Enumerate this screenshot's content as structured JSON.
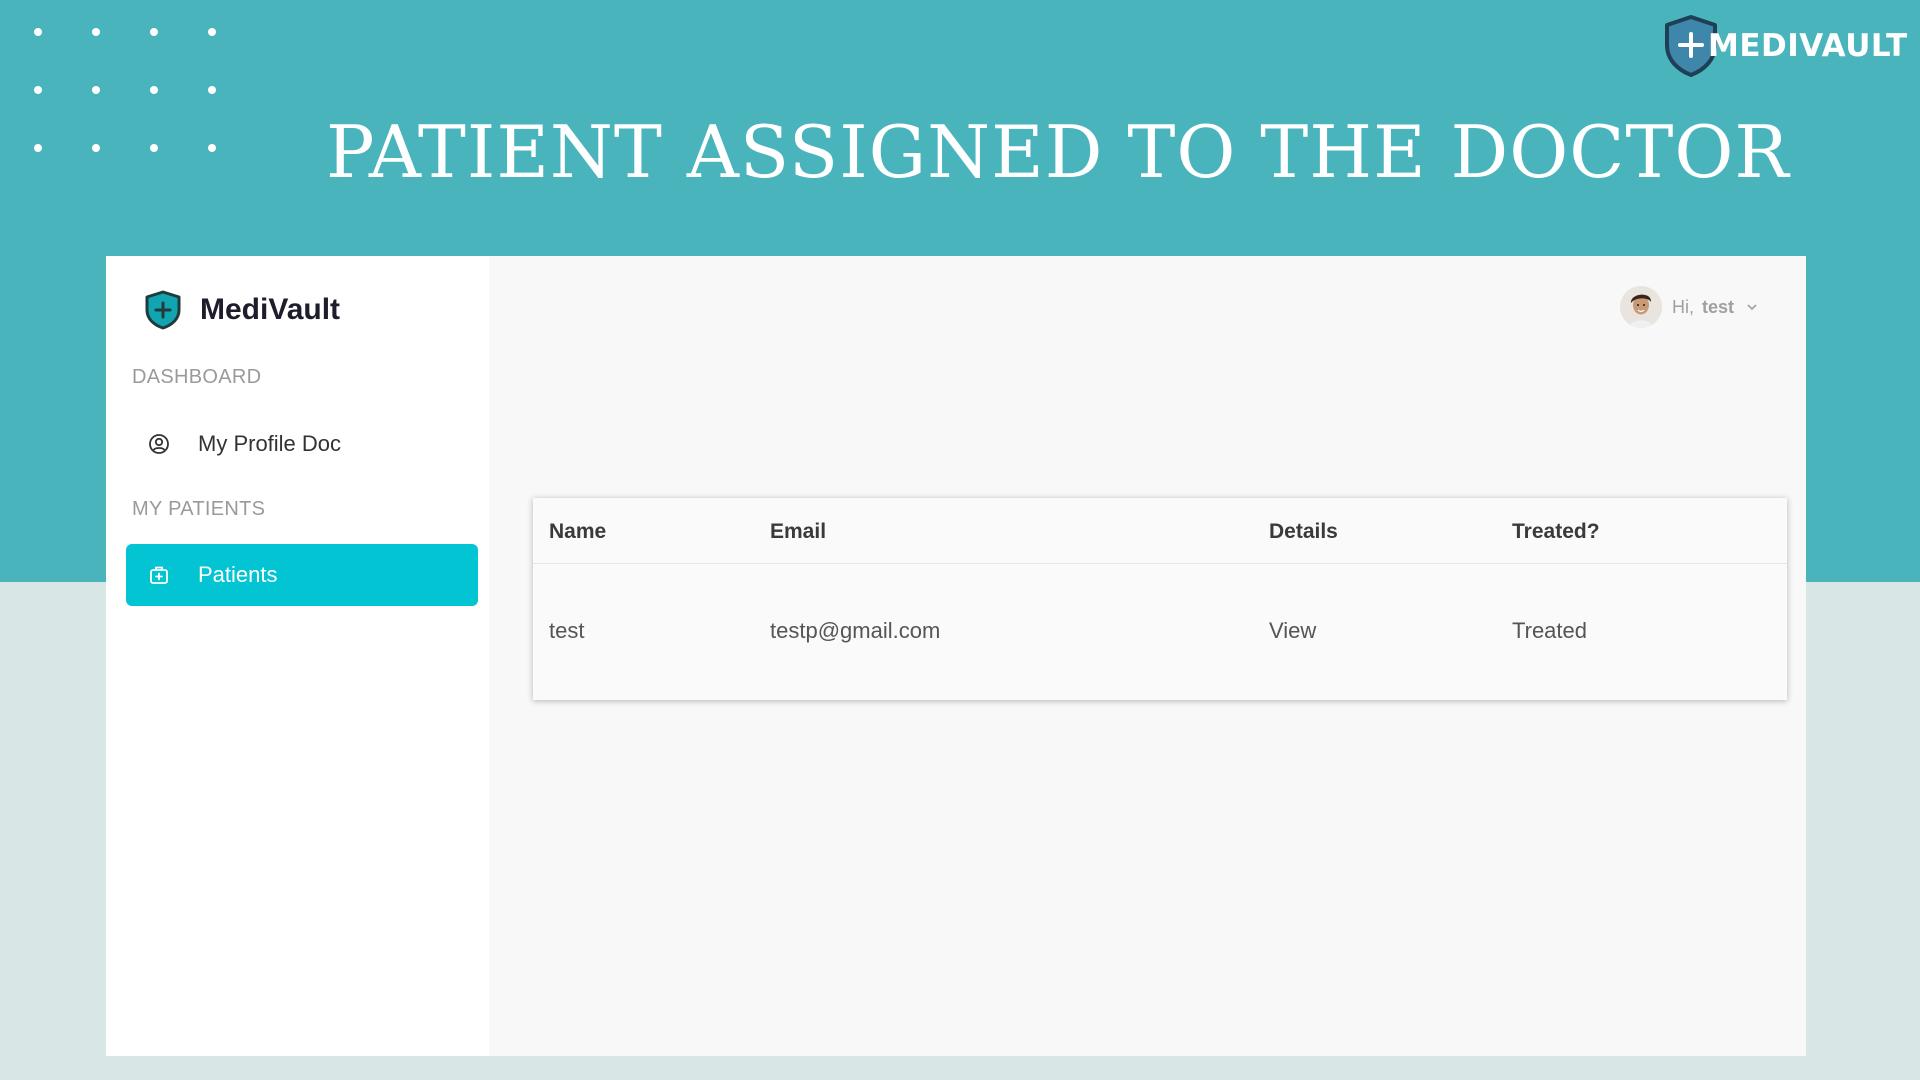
{
  "slide": {
    "title": "PATIENT ASSIGNED TO THE DOCTOR",
    "brand_label": "MEDIVAULT",
    "colors": {
      "banner": "#4ab4bd",
      "background": "#d9e6e6"
    }
  },
  "app": {
    "logo_text": "MediVault",
    "sidebar": {
      "sections": [
        {
          "label": "DASHBOARD",
          "items": [
            {
              "label": "My Profile Doc",
              "icon": "user-circle-icon",
              "active": false
            }
          ]
        },
        {
          "label": "MY PATIENTS",
          "items": [
            {
              "label": "Patients",
              "icon": "medical-bag-icon",
              "active": true
            }
          ]
        }
      ],
      "active_color": "#03c4d3"
    },
    "user": {
      "greeting": "Hi,",
      "name": "test",
      "avatar_icon": "user-avatar",
      "menu_icon": "chevron-down-icon"
    },
    "table": {
      "columns": [
        "Name",
        "Email",
        "Details",
        "Treated?"
      ],
      "rows": [
        [
          "test",
          "testp@gmail.com",
          "View",
          "Treated"
        ]
      ]
    }
  }
}
